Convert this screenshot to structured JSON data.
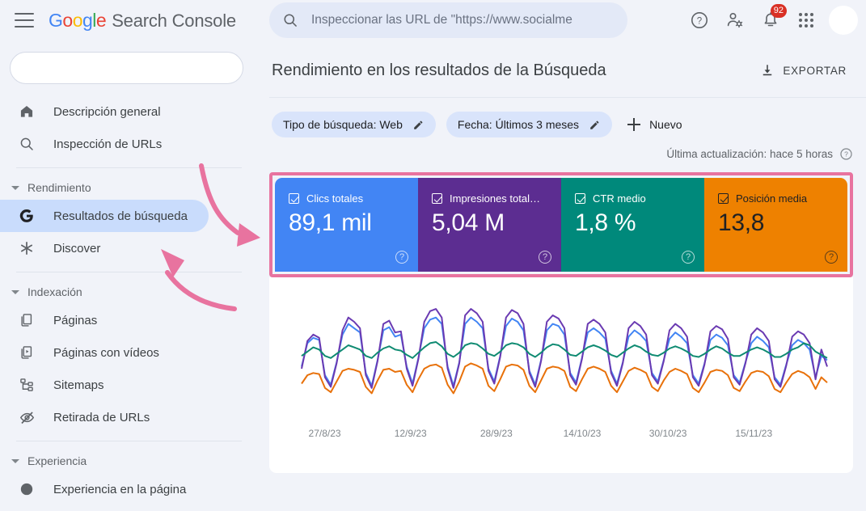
{
  "topbar": {
    "menu_label": "Menú",
    "logo_text": "Google",
    "product_name": "Search Console",
    "search_placeholder": "Inspeccionar las URL de \"https://www.socialme",
    "search_value": "",
    "notifications_count": "92",
    "help_icon": "help-icon",
    "account_settings_icon": "user-settings-icon",
    "notifications_icon": "bell-icon",
    "apps_icon": "apps-grid-icon",
    "avatar_icon": "avatar"
  },
  "sidebar": {
    "property_selector_value": "",
    "items": [
      {
        "label": "Descripción general",
        "icon": "home-icon",
        "active": false
      },
      {
        "label": "Inspección de URLs",
        "icon": "search-icon",
        "active": false
      }
    ],
    "groups": [
      {
        "label": "Rendimiento",
        "items": [
          {
            "label": "Resultados de búsqueda",
            "icon": "google-g-icon",
            "active": true
          },
          {
            "label": "Discover",
            "icon": "asterisk-icon",
            "active": false
          }
        ]
      },
      {
        "label": "Indexación",
        "items": [
          {
            "label": "Páginas",
            "icon": "pages-icon",
            "active": false
          },
          {
            "label": "Páginas con vídeos",
            "icon": "video-pages-icon",
            "active": false
          },
          {
            "label": "Sitemaps",
            "icon": "sitemap-icon",
            "active": false
          },
          {
            "label": "Retirada de URLs",
            "icon": "eye-off-icon",
            "active": false
          }
        ]
      },
      {
        "label": "Experiencia",
        "items": [
          {
            "label": "Experiencia en la página",
            "icon": "experience-icon",
            "active": false
          }
        ]
      }
    ]
  },
  "main": {
    "page_title": "Rendimiento en los resultados de la Búsqueda",
    "export_label": "EXPORTAR",
    "export_icon": "download-icon",
    "chips": [
      {
        "label": "Tipo de búsqueda: Web",
        "edit_icon": "pencil-icon"
      },
      {
        "label": "Fecha: Últimos 3 meses",
        "edit_icon": "pencil-icon"
      }
    ],
    "new_filter_label": "Nuevo",
    "new_filter_icon": "plus-icon",
    "last_update": "Última actualización: hace 5 horas",
    "last_update_help_icon": "help-icon",
    "highlight_color": "#e8739f",
    "metrics": [
      {
        "label": "Clics totales",
        "value": "89,1 mil",
        "color": "#4285f4",
        "text_color": "#ffffff",
        "checked": true,
        "help_icon": "help-icon"
      },
      {
        "label": "Impresiones total…",
        "value": "5,04 M",
        "color": "#5c2d91",
        "text_color": "#ffffff",
        "checked": true,
        "help_icon": "help-icon"
      },
      {
        "label": "CTR medio",
        "value": "1,8 %",
        "color": "#00897b",
        "text_color": "#ffffff",
        "checked": true,
        "help_icon": "help-icon"
      },
      {
        "label": "Posición media",
        "value": "13,8",
        "color": "#ee8100",
        "text_color": "#202124",
        "checked": true,
        "help_icon": "help-icon"
      }
    ]
  },
  "chart_data": {
    "type": "line",
    "title": "",
    "xlabel": "",
    "ylabel": "",
    "grid": false,
    "legend": "none",
    "x_tick_labels": [
      "27/8/23",
      "12/9/23",
      "28/9/23",
      "14/10/23",
      "30/10/23",
      "15/11/23"
    ],
    "x_tick_positions_pct": [
      9.5,
      24.2,
      38.9,
      53.6,
      68.3,
      83.0
    ],
    "series": [
      {
        "name": "Clics totales",
        "color": "#4285f4",
        "values": [
          30,
          52,
          57,
          55,
          22,
          13,
          34,
          60,
          70,
          66,
          62,
          24,
          12,
          36,
          64,
          67,
          58,
          60,
          30,
          14,
          38,
          66,
          74,
          76,
          70,
          30,
          12,
          34,
          70,
          76,
          72,
          66,
          28,
          16,
          40,
          68,
          75,
          72,
          64,
          26,
          13,
          36,
          64,
          70,
          68,
          60,
          24,
          15,
          38,
          62,
          66,
          62,
          56,
          26,
          14,
          34,
          58,
          64,
          60,
          54,
          24,
          16,
          36,
          56,
          62,
          58,
          52,
          22,
          14,
          33,
          55,
          60,
          57,
          50,
          22,
          15,
          34,
          52,
          58,
          54,
          48,
          20,
          13,
          32,
          50,
          55,
          52,
          46,
          20,
          40,
          36
        ]
      },
      {
        "name": "Impresiones totales",
        "color": "#6a3ab2",
        "values": [
          28,
          54,
          60,
          57,
          20,
          11,
          33,
          64,
          76,
          72,
          66,
          22,
          10,
          35,
          70,
          73,
          62,
          63,
          28,
          12,
          37,
          72,
          82,
          84,
          76,
          28,
          10,
          33,
          78,
          84,
          80,
          72,
          26,
          14,
          39,
          76,
          83,
          80,
          70,
          24,
          11,
          35,
          72,
          78,
          75,
          66,
          22,
          13,
          37,
          70,
          74,
          70,
          62,
          24,
          12,
          33,
          66,
          72,
          68,
          60,
          22,
          14,
          35,
          64,
          70,
          66,
          58,
          20,
          12,
          32,
          63,
          68,
          65,
          56,
          20,
          13,
          33,
          60,
          66,
          62,
          54,
          18,
          11,
          31,
          58,
          63,
          60,
          52,
          18,
          46,
          30
        ]
      },
      {
        "name": "CTR medio",
        "color": "#0f8b72",
        "values": [
          40,
          44,
          48,
          46,
          40,
          38,
          42,
          46,
          50,
          48,
          46,
          40,
          38,
          43,
          47,
          49,
          46,
          45,
          41,
          38,
          43,
          48,
          52,
          53,
          49,
          42,
          39,
          43,
          50,
          52,
          51,
          47,
          42,
          40,
          44,
          50,
          52,
          51,
          48,
          42,
          39,
          43,
          48,
          51,
          50,
          46,
          41,
          40,
          44,
          48,
          50,
          48,
          45,
          41,
          39,
          43,
          47,
          50,
          48,
          44,
          41,
          40,
          43,
          47,
          49,
          47,
          44,
          40,
          39,
          42,
          46,
          49,
          47,
          43,
          40,
          40,
          43,
          46,
          48,
          46,
          43,
          39,
          39,
          42,
          46,
          48,
          52,
          50,
          44,
          41,
          38
        ]
      },
      {
        "name": "Posición media",
        "color": "#e8710a",
        "values": [
          14,
          22,
          24,
          23,
          10,
          6,
          16,
          26,
          28,
          27,
          25,
          11,
          5,
          17,
          27,
          28,
          25,
          26,
          13,
          6,
          18,
          28,
          31,
          32,
          29,
          13,
          5,
          16,
          30,
          33,
          31,
          28,
          12,
          7,
          18,
          30,
          32,
          31,
          27,
          12,
          6,
          17,
          28,
          30,
          29,
          26,
          11,
          7,
          18,
          28,
          30,
          28,
          25,
          12,
          6,
          16,
          26,
          29,
          27,
          24,
          11,
          7,
          17,
          25,
          28,
          26,
          23,
          10,
          6,
          15,
          25,
          27,
          26,
          22,
          10,
          7,
          16,
          24,
          26,
          25,
          21,
          9,
          6,
          15,
          23,
          26,
          24,
          20,
          9,
          20,
          15
        ]
      }
    ]
  }
}
